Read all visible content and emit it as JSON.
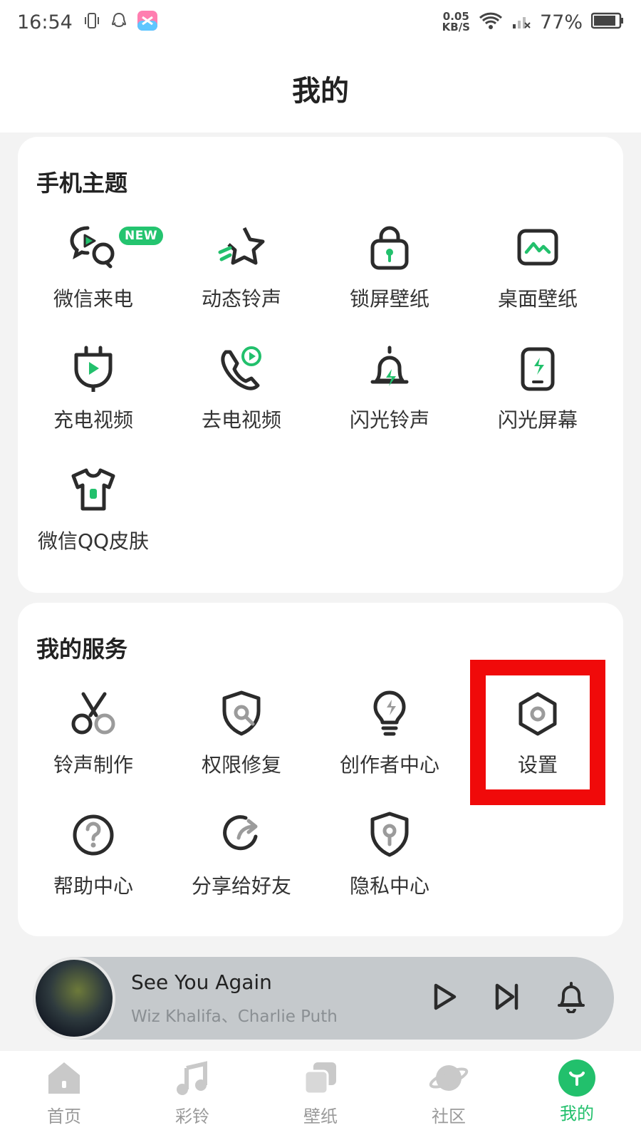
{
  "status_bar": {
    "time": "16:54",
    "speed_value": "0.05",
    "speed_unit": "KB/S",
    "battery": "77%"
  },
  "header": {
    "title": "我的"
  },
  "theme_section": {
    "title": "手机主题",
    "new_badge": "NEW",
    "items": [
      {
        "label": "微信来电",
        "icon": "wechat-call-icon"
      },
      {
        "label": "动态铃声",
        "icon": "star-ringtone-icon"
      },
      {
        "label": "锁屏壁纸",
        "icon": "lock-wallpaper-icon"
      },
      {
        "label": "桌面壁纸",
        "icon": "desktop-wallpaper-icon"
      },
      {
        "label": "充电视频",
        "icon": "charging-video-icon"
      },
      {
        "label": "去电视频",
        "icon": "outgoing-call-video-icon"
      },
      {
        "label": "闪光铃声",
        "icon": "flash-bell-icon"
      },
      {
        "label": "闪光屏幕",
        "icon": "flash-screen-icon"
      },
      {
        "label": "微信QQ皮肤",
        "icon": "tshirt-skin-icon"
      }
    ]
  },
  "services_section": {
    "title": "我的服务",
    "items": [
      {
        "label": "铃声制作",
        "icon": "scissors-icon"
      },
      {
        "label": "权限修复",
        "icon": "shield-wrench-icon"
      },
      {
        "label": "创作者中心",
        "icon": "lightbulb-icon"
      },
      {
        "label": "设置",
        "icon": "hexagon-settings-icon"
      },
      {
        "label": "帮助中心",
        "icon": "help-icon"
      },
      {
        "label": "分享给好友",
        "icon": "share-icon"
      },
      {
        "label": "隐私中心",
        "icon": "privacy-shield-icon"
      }
    ]
  },
  "player": {
    "title": "See You Again",
    "artist": "Wiz Khalifa、Charlie Puth"
  },
  "tabbar": {
    "tabs": [
      {
        "label": "首页",
        "icon": "home-icon"
      },
      {
        "label": "彩铃",
        "icon": "music-note-icon"
      },
      {
        "label": "壁纸",
        "icon": "wallpaper-icon"
      },
      {
        "label": "社区",
        "icon": "planet-icon"
      },
      {
        "label": "我的",
        "icon": "profile-icon"
      }
    ],
    "active_index": 4
  },
  "colors": {
    "accent": "#22c06c",
    "highlight": "#f00a0a"
  }
}
